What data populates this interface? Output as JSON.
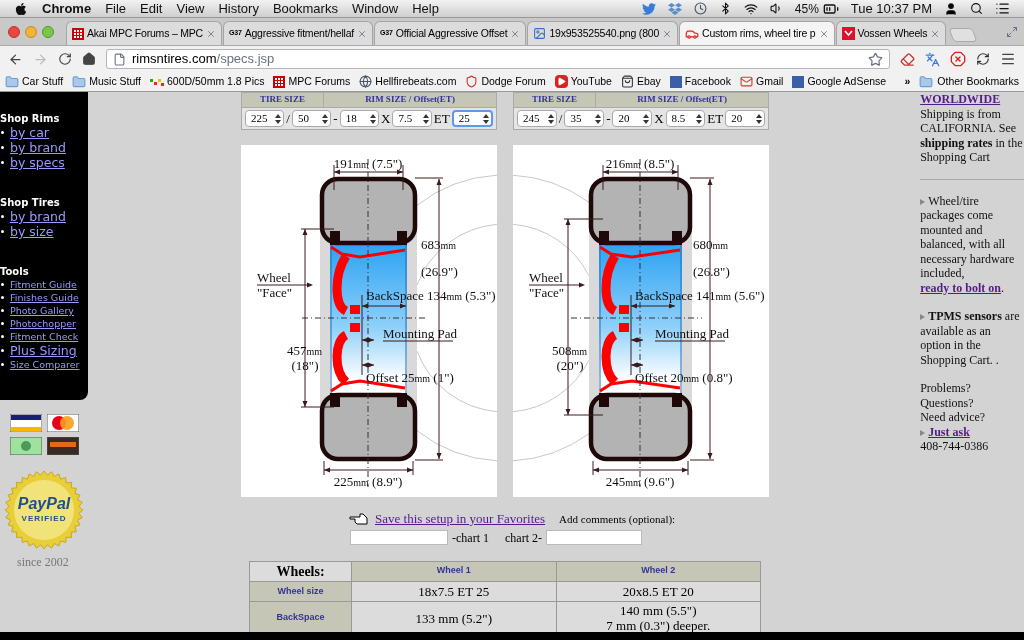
{
  "menubar": {
    "app": "Chrome",
    "menus": [
      "File",
      "Edit",
      "View",
      "History",
      "Bookmarks",
      "Window",
      "Help"
    ],
    "battery": "45%",
    "clock": "Tue 10:37 PM"
  },
  "tabs": [
    {
      "title": "Akai MPC Forums – MPC",
      "selected": false
    },
    {
      "title": "Aggressive fitment/hellaf",
      "badge": "G37",
      "selected": false
    },
    {
      "title": "Official Aggressive Offset",
      "badge": "G37",
      "selected": false
    },
    {
      "title": "19x953525540.png (800",
      "selected": false
    },
    {
      "title": "Custom rims, wheel tire p",
      "selected": true
    },
    {
      "title": "Vossen Wheels",
      "selected": false
    }
  ],
  "address": {
    "host": "rimsntires.com",
    "path": "/specs.jsp"
  },
  "bookmarks": [
    "Car Stuff",
    "Music Stuff",
    "600D/50mm 1.8 Pics",
    "MPC Forums",
    "Hellfirebeats.com",
    "Dodge Forum",
    "YouTube",
    "Ebay",
    "Facebook",
    "Gmail",
    "Google AdSense"
  ],
  "more_bookmarks": "»",
  "other_bookmarks": "Other Bookmarks",
  "sidebar": [
    {
      "heading": "Shop Rims",
      "links": [
        {
          "label": "by car",
          "kind": "large"
        },
        {
          "label": "by brand",
          "kind": "large"
        },
        {
          "label": "by specs",
          "kind": "large"
        }
      ]
    },
    {
      "heading": "Shop Tires",
      "links": [
        {
          "label": "by brand",
          "kind": "large"
        },
        {
          "label": "by size",
          "kind": "large"
        }
      ]
    },
    {
      "heading": "Tools",
      "links": [
        {
          "label": "Fitment Guide",
          "kind": "small"
        },
        {
          "label": "Finishes Guide",
          "kind": "small"
        },
        {
          "label": "Photo Gallery",
          "kind": "small"
        },
        {
          "label": "Photochopper",
          "kind": "small"
        },
        {
          "label": "Fitment Check",
          "kind": "small"
        },
        {
          "label": "Plus Sizing",
          "kind": "large"
        },
        {
          "label": "Size Comparer",
          "kind": "small"
        }
      ]
    }
  ],
  "seal": {
    "brand": "PayPal",
    "status": "VERIFIED",
    "since": "since 2002"
  },
  "wheels": [
    {
      "header": [
        "TIRE SIZE",
        "RIM SIZE / Offset(ET)"
      ],
      "fields": [
        {
          "kind": "select",
          "value": "225",
          "focused": false
        },
        {
          "kind": "separator",
          "text": "/"
        },
        {
          "kind": "select",
          "value": "50",
          "focused": false
        },
        {
          "kind": "separator",
          "text": "-"
        },
        {
          "kind": "select",
          "value": "18",
          "focused": false
        },
        {
          "kind": "separator",
          "text": "X"
        },
        {
          "kind": "select",
          "value": "7.5",
          "focused": false
        },
        {
          "kind": "separator",
          "text": "ET"
        },
        {
          "kind": "select",
          "value": "25",
          "focused": true
        }
      ],
      "diagram": {
        "width": {
          "value": "191",
          "unit": "mm",
          "inches": " (7.5\")"
        },
        "diameter": {
          "value": "683",
          "unit": "mm",
          "inches": "(26.9\")"
        },
        "face": [
          "Wheel",
          "\"Face\""
        ],
        "backspace": {
          "prefix": "BackSpace ",
          "value": "134",
          "unit": "mm",
          "inches": " (5.3\")"
        },
        "pad": "Mounting Pad",
        "rim": {
          "value": "457",
          "unit": "mm",
          "inches": "(18\")"
        },
        "offset": {
          "prefix": "Offset ",
          "value": "25",
          "unit": "mm",
          "inches": " (1\")"
        },
        "tire": {
          "value": "225",
          "unit": "mm",
          "inches": " (8.9\")"
        }
      }
    },
    {
      "header": [
        "TIRE SIZE",
        "RIM SIZE / Offset(ET)"
      ],
      "fields": [
        {
          "kind": "select",
          "value": "245",
          "focused": false
        },
        {
          "kind": "separator",
          "text": "/"
        },
        {
          "kind": "select",
          "value": "35",
          "focused": false
        },
        {
          "kind": "separator",
          "text": "-"
        },
        {
          "kind": "select",
          "value": "20",
          "focused": false
        },
        {
          "kind": "separator",
          "text": "X"
        },
        {
          "kind": "select",
          "value": "8.5",
          "focused": false
        },
        {
          "kind": "separator",
          "text": "ET"
        },
        {
          "kind": "select",
          "value": "20",
          "focused": false
        }
      ],
      "diagram": {
        "width": {
          "value": "216",
          "unit": "mm",
          "inches": " (8.5\")"
        },
        "diameter": {
          "value": "680",
          "unit": "mm",
          "inches": "(26.8\")"
        },
        "face": [
          "Wheel",
          "\"Face\""
        ],
        "backspace": {
          "prefix": "BackSpace ",
          "value": "141",
          "unit": "mm",
          "inches": " (5.6\")"
        },
        "pad": "Mounting Pad",
        "rim": {
          "value": "508",
          "unit": "mm",
          "inches": "(20\")"
        },
        "offset": {
          "prefix": "Offset ",
          "value": "20",
          "unit": "mm",
          "inches": " (0.8\")"
        },
        "tire": {
          "value": "245",
          "unit": "mm",
          "inches": " (9.6\")"
        }
      }
    }
  ],
  "favorites": {
    "link": "Save this setup in your Favorites",
    "comments_label": "Add comments (optional):",
    "chart1_label": "-chart 1",
    "chart2_label": "chart 2-"
  },
  "table": {
    "corner": "Wheels:",
    "columns": [
      "Wheel 1",
      "Wheel 2"
    ],
    "rows": [
      {
        "label": "Wheel size",
        "cells": [
          [
            "18x7.5 ET 25"
          ],
          [
            "20x8.5 ET 20"
          ]
        ]
      },
      {
        "label": "BackSpace",
        "cells": [
          [
            "133 mm (5.2\")"
          ],
          [
            "140 mm (5.5\")",
            "7 mm (0.3\") deeper."
          ]
        ]
      }
    ]
  },
  "info": {
    "heading": "WORLDWIDE",
    "shipping": "Shipping is from CALIFORNIA. See **shipping rates** in the Shopping Cart",
    "packages": {
      "text": "Wheel/tire packages come mounted and balanced, with all necessary hardware included, ",
      "link": "ready to bolt on",
      "end": "."
    },
    "tpms": "**TPMS sensors** are available as an option in the Shopping Cart. .",
    "help": [
      "Problems?",
      "Questions?",
      "Need advice?"
    ],
    "ask": "Just ask",
    "phone": "408-744-0386"
  }
}
